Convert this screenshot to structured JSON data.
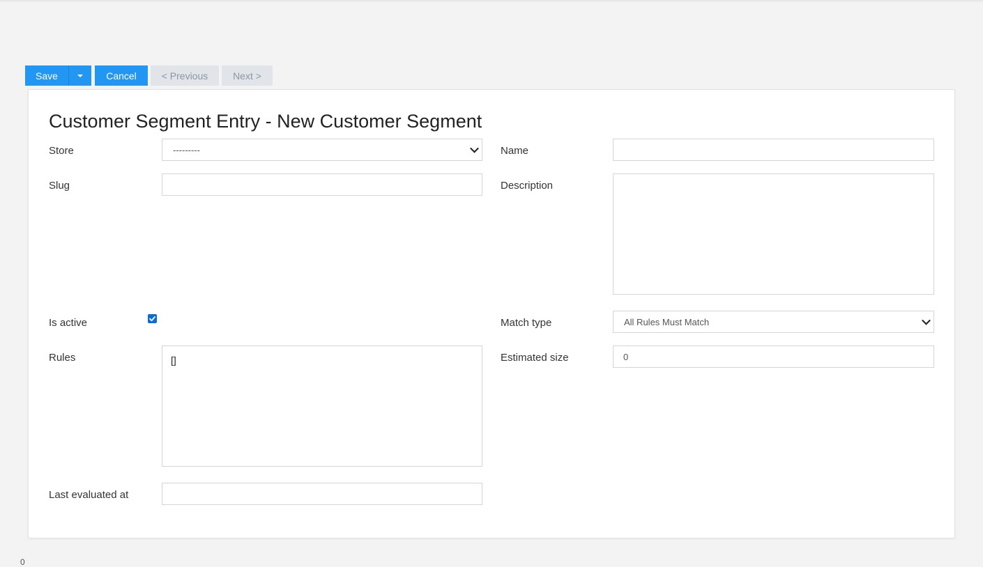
{
  "toolbar": {
    "save_label": "Save",
    "cancel_label": "Cancel",
    "previous_label": "< Previous",
    "next_label": "Next >"
  },
  "form": {
    "title": "Customer Segment Entry - New Customer Segment",
    "store": {
      "label": "Store",
      "value": "---------"
    },
    "name": {
      "label": "Name",
      "value": ""
    },
    "slug": {
      "label": "Slug",
      "value": ""
    },
    "description": {
      "label": "Description",
      "value": ""
    },
    "is_active": {
      "label": "Is active",
      "checked": true
    },
    "match_type": {
      "label": "Match type",
      "value": "All Rules Must Match"
    },
    "rules": {
      "label": "Rules",
      "value": "[]"
    },
    "estimated_size": {
      "label": "Estimated size",
      "value": "0"
    },
    "last_evaluated_at": {
      "label": "Last evaluated at",
      "value": ""
    }
  },
  "footer": {
    "glyph": "0"
  },
  "colors": {
    "primary": "#2196f3",
    "secondary_bg": "#e1e5ea",
    "secondary_text": "#8a96a3",
    "page_bg": "#f3f3f3"
  }
}
